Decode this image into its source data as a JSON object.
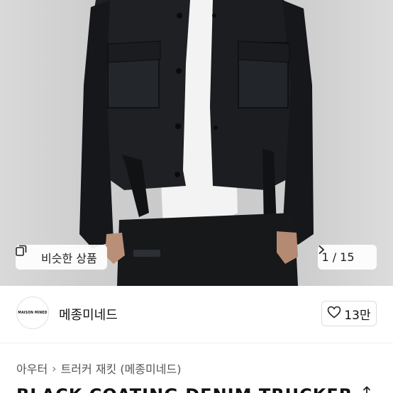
{
  "gallery": {
    "similar_label": "비슷한 상품",
    "counter_current": "1",
    "counter_separator": "/",
    "counter_total": "15",
    "counter_text": "1 / 15"
  },
  "store": {
    "logo_text": "MAISON MINED",
    "name": "메종미네드",
    "follow_count": "13만"
  },
  "breadcrumb": {
    "items": [
      "아우터",
      "트러커 재킷 (메종미네드)"
    ]
  },
  "product": {
    "title": "BLACK COATING DENIM TRUCKER"
  },
  "icons": {
    "similar": "similar-products-icon",
    "next": "chevron-right-icon",
    "heart": "heart-icon",
    "share": "share-icon"
  }
}
